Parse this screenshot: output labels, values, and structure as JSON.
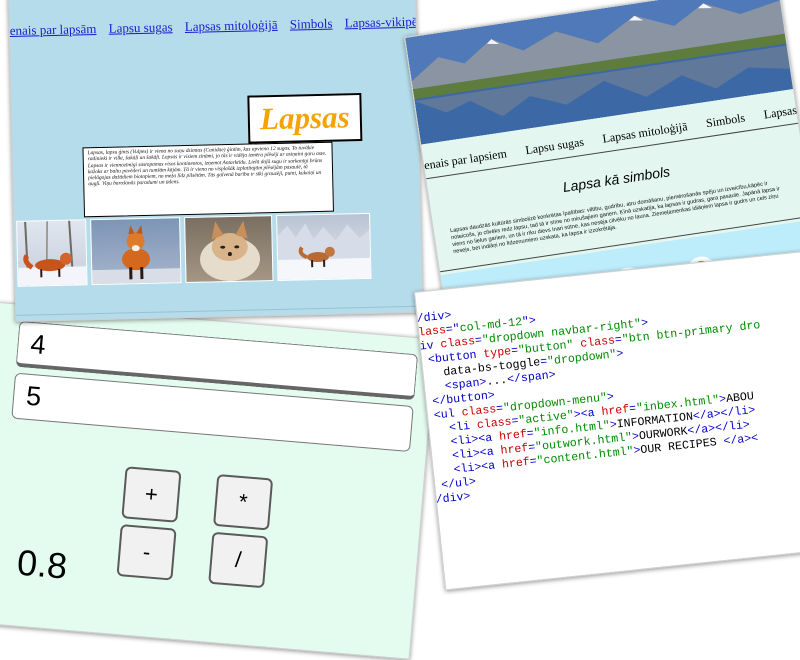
{
  "lapsas_page": {
    "nav": [
      "enais par lapsām",
      "Lapsu sugas",
      "Lapsas mitoloģijā",
      "Simbols",
      "Lapsas-vikipēdi"
    ],
    "title": "Lapsas",
    "intro": "Lapsas, lapsu ģints (Vulpes) ir viena no suņu dzimtas (Canidae) ģintīm, kas apvieno 12 sugas. To tuvākie radinieki ir vilki, šakāļi un šakāļi. Lapsas ir visiem zināmi, jo tās ir vidēja izmēra plēsēji ar asiņaini garu aste. Lapsas ir viennozīmīgi sastopamas visos kontinentos, izņemot Antarktīdu. Lielā daļā sugu ir sarkanīgi brūns kažoks ar baltu pavēderi un tumšām kājām. Tā ir viena no visplašāk izplatītajām plēsējām pasaulē, tā pielāgojas dažādiem biotopiem, no meža līdz pilsētām. Tās galvenā barība ir sīki grauzēji, putni, kukaiņi un augļi. Viņu barošanās paradumi un ūdens."
  },
  "symbol_page": {
    "nav": [
      "enais par lapsiem",
      "Lapsu sugas",
      "Lapsas mitoloģijā",
      "Simbols",
      "Lapsas-vikipēdij"
    ],
    "heading": "Lapsa kā simbols",
    "body": "Lapsas daudzās kultūrās simbolizē konkrētas īpašības: viltību, gudrību, atru domāšanu, piemērošanās spēju un izveicību,kāpēc ir noteicošs, jo cilvēks redz lapsu, tad tā ir sīme no mirušajiem gariem. Ķīnā uzskatīja, ka lapsas ir gudras, gara pasaule. Japānā lapsa ir viens no lielus gariem, un tā ir rīku dievs Inari sūtne, kas nesēja cilvēku no launa. Ziemeļamerikas idiāņiem lapsa ir gudrs un cels ziņu nesejs, bet indiāņi no līdzenumiem uzskata, ka lapsa ir izzokrētāja.",
    "footer_icons": [
      "wikipedia-icon",
      "apple-icon",
      "google-icon"
    ]
  },
  "calculator": {
    "input1": "4",
    "input2": "5",
    "buttons": [
      "+",
      "*",
      "-",
      "/"
    ],
    "result": "0.8"
  },
  "code_snippet": {
    "lines": [
      [
        [
          "t",
          "</div>"
        ]
      ],
      [
        [
          "a",
          "class"
        ],
        [
          "t",
          "=\""
        ],
        [
          "v",
          "col-md-12"
        ],
        [
          "t",
          "\">"
        ]
      ],
      [
        [
          "t",
          "div "
        ],
        [
          "a",
          "class"
        ],
        [
          "t",
          "="
        ],
        [
          "v",
          "\"dropdown navbar-right\""
        ],
        [
          "t",
          ">"
        ]
      ],
      [
        [
          "t",
          "  <button "
        ],
        [
          "a",
          "type"
        ],
        [
          "t",
          "="
        ],
        [
          "v",
          "\"button\""
        ],
        [
          "t",
          " "
        ],
        [
          "a",
          "class"
        ],
        [
          "t",
          "="
        ],
        [
          "v",
          "\"btn btn-primary dro"
        ]
      ],
      [
        [
          "x",
          "    data-bs-toggle"
        ],
        [
          "t",
          "="
        ],
        [
          "v",
          "\"dropdown\""
        ],
        [
          "t",
          ">"
        ]
      ],
      [
        [
          "t",
          "    <span>"
        ],
        [
          "x",
          "..."
        ],
        [
          "t",
          "</span>"
        ]
      ],
      [
        [
          "t",
          "  </button>"
        ]
      ],
      [
        [
          "t",
          "  <ul "
        ],
        [
          "a",
          "class"
        ],
        [
          "t",
          "="
        ],
        [
          "v",
          "\"dropdown-menu\""
        ],
        [
          "t",
          ">"
        ]
      ],
      [
        [
          "t",
          "    <li "
        ],
        [
          "a",
          "class"
        ],
        [
          "t",
          "="
        ],
        [
          "v",
          "\"active\""
        ],
        [
          "t",
          "><a "
        ],
        [
          "a",
          "href"
        ],
        [
          "t",
          "="
        ],
        [
          "v",
          "\"inbex.html\""
        ],
        [
          "t",
          ">"
        ],
        [
          "x",
          "ABOU"
        ]
      ],
      [
        [
          "t",
          "    <li><a "
        ],
        [
          "a",
          "href"
        ],
        [
          "t",
          "="
        ],
        [
          "v",
          "\"info.html\""
        ],
        [
          "t",
          ">"
        ],
        [
          "x",
          "INFORMATION"
        ],
        [
          "t",
          "</a></li>"
        ]
      ],
      [
        [
          "t",
          "    <li><a "
        ],
        [
          "a",
          "href"
        ],
        [
          "t",
          "="
        ],
        [
          "v",
          "\"outwork.html\""
        ],
        [
          "t",
          ">"
        ],
        [
          "x",
          "OURWORK"
        ],
        [
          "t",
          "</a></li>"
        ]
      ],
      [
        [
          "t",
          "    <li><a "
        ],
        [
          "a",
          "href"
        ],
        [
          "t",
          "="
        ],
        [
          "v",
          "\"content.html\""
        ],
        [
          "t",
          ">"
        ],
        [
          "x",
          "OUR RECIPES"
        ],
        [
          "t",
          " </a><"
        ]
      ],
      [
        [
          "t",
          "  </ul>"
        ]
      ],
      [
        [
          "t",
          "</div>"
        ]
      ]
    ]
  },
  "colors": {
    "lapsas_bg": "#b5dcea",
    "title_orange": "#f5a300",
    "symbol_bg": "#e3f7f0",
    "symbol_footer": "#bdecfa",
    "calc_bg": "#e4fbef",
    "code_tag": "#0000c8",
    "code_attr": "#c80000",
    "code_value": "#008c00"
  }
}
